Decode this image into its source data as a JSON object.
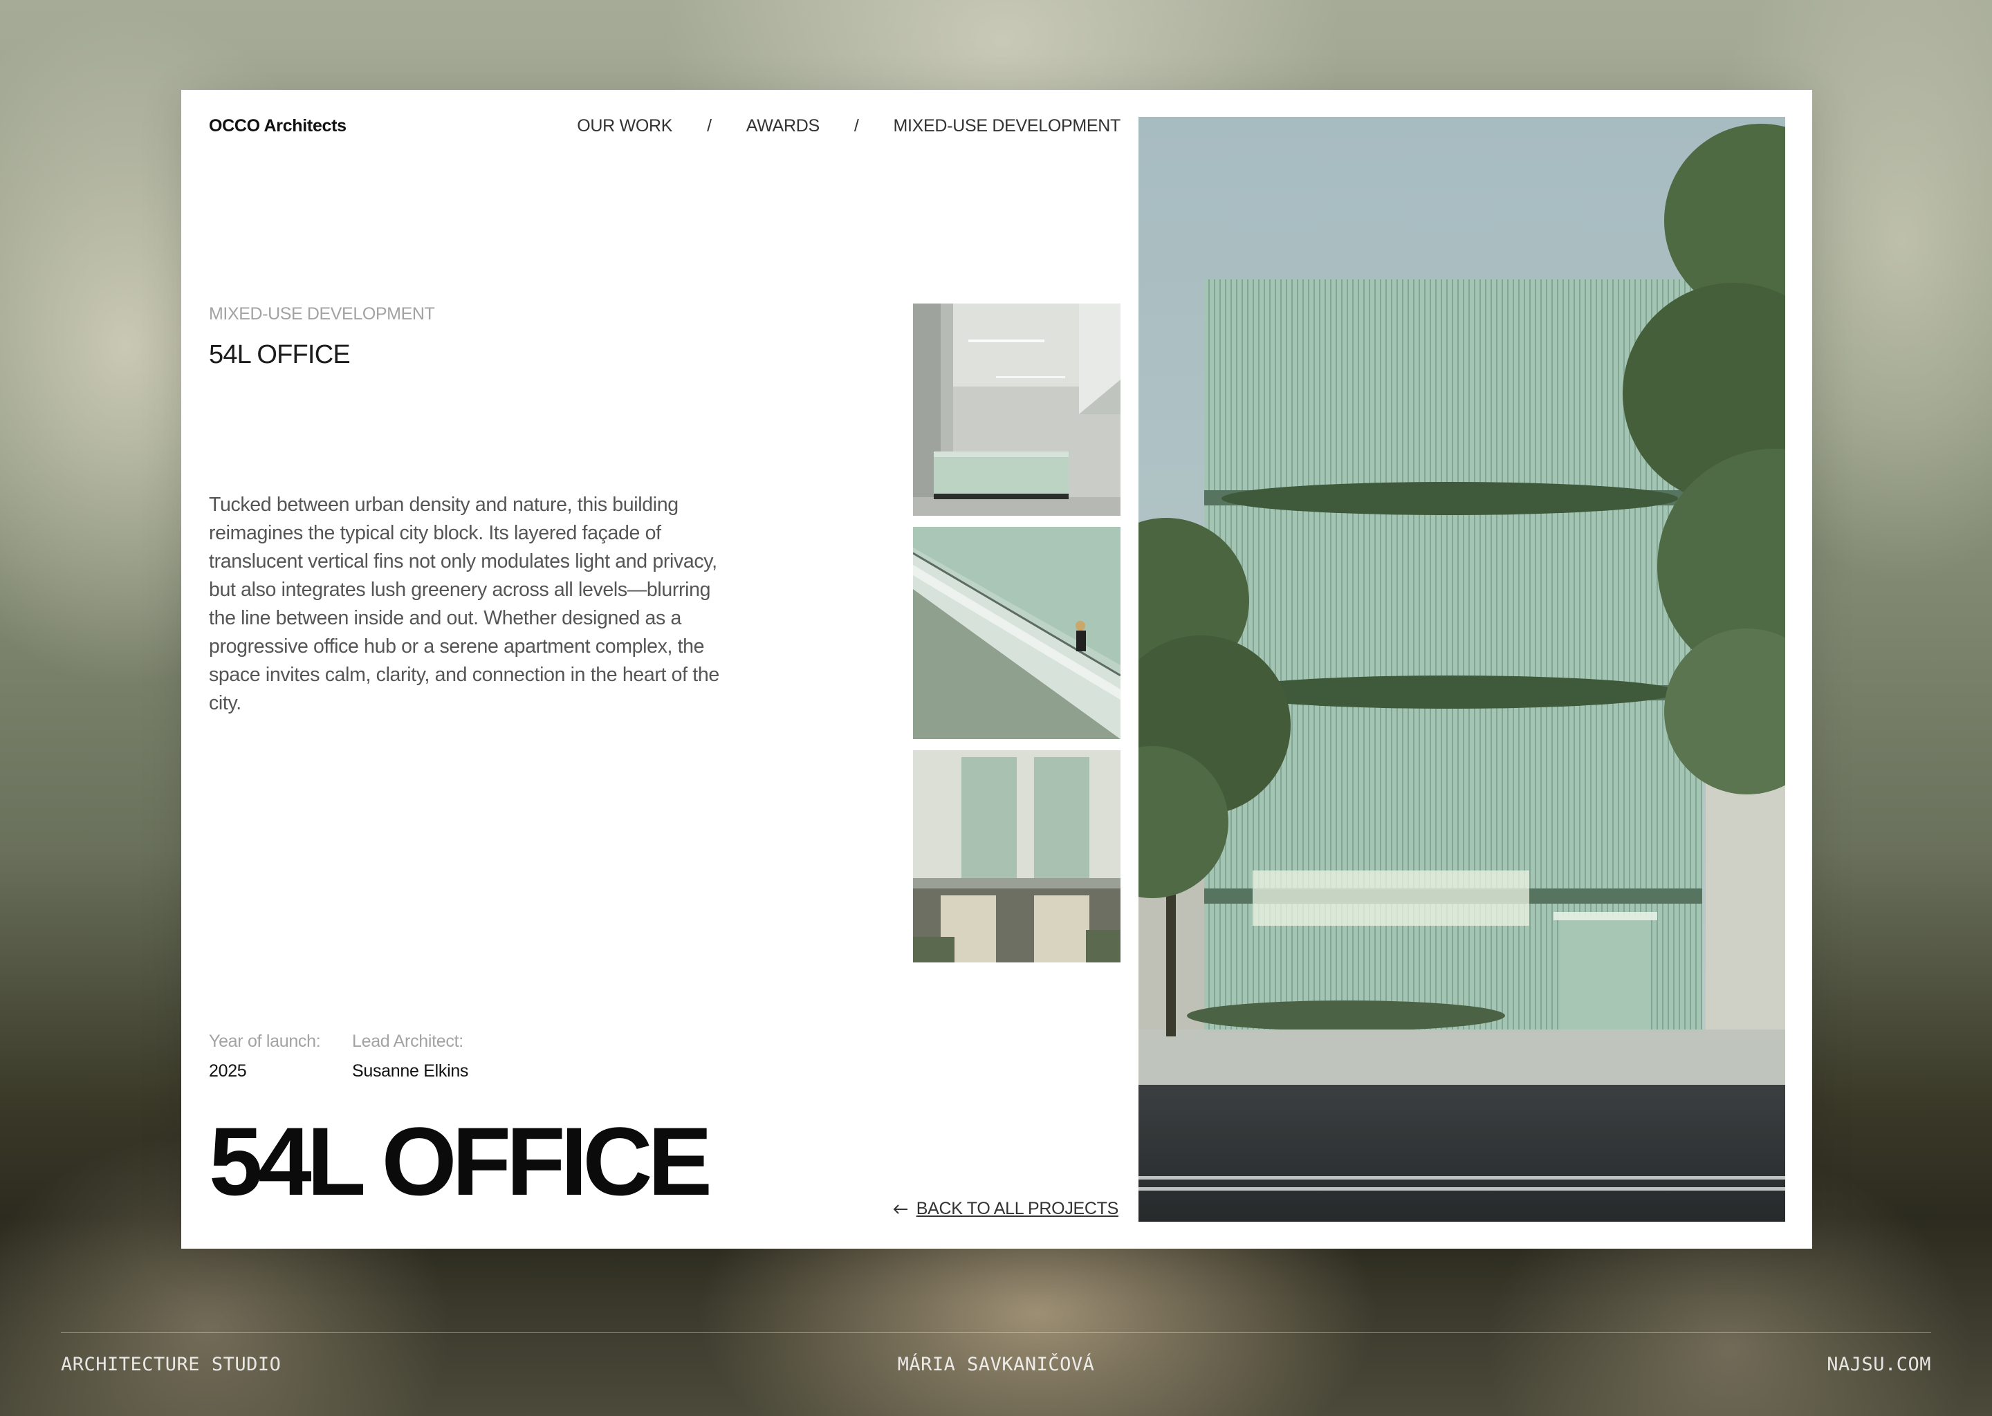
{
  "header": {
    "brand": "OCCO Architects",
    "nav": [
      "OUR WORK",
      "AWARDS",
      "MIXED-USE DEVELOPMENT"
    ],
    "separator": "/"
  },
  "project": {
    "category": "MIXED-USE DEVELOPMENT",
    "title": "54L OFFICE",
    "description": "Tucked between urban density and nature, this building reimagines the typical city block. Its layered façade of translucent vertical fins not only modulates light and privacy, but also integrates lush greenery across all levels—blurring the line between inside and out. Whether designed as a progressive office hub or a serene apartment complex, the space invites calm, clarity, and connection in the heart of the city.",
    "year_label": "Year of launch:",
    "year": "2025",
    "architect_label": "Lead Architect:",
    "architect": "Susanne Elkins",
    "big_title": "54L OFFICE",
    "back_link": "BACK TO ALL PROJECTS"
  },
  "footer": {
    "left": "ARCHITECTURE STUDIO",
    "center": "MÁRIA SAVKANIČOVÁ",
    "right": "NAJSU.COM"
  },
  "colors": {
    "facade_green": "#9dbfad",
    "card_bg": "#ffffff",
    "text_muted": "#a3a3a3"
  }
}
